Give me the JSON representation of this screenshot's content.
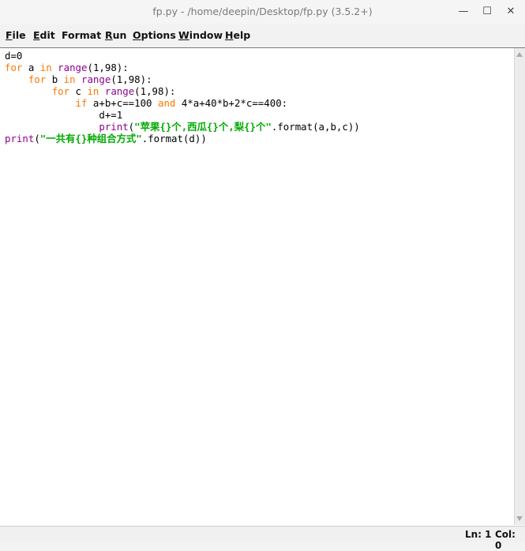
{
  "window": {
    "title": "fp.py - /home/deepin/Desktop/fp.py (3.5.2+)",
    "minimize_glyph": "—",
    "maximize_glyph": "☐",
    "close_glyph": "✕"
  },
  "menu": [
    {
      "u": "F",
      "rest": "ile"
    },
    {
      "u": "E",
      "rest": "dit"
    },
    {
      "u": "",
      "rest": "Format"
    },
    {
      "u": "R",
      "rest": "un"
    },
    {
      "u": "O",
      "rest": "ptions"
    },
    {
      "u": "W",
      "rest": "indow"
    },
    {
      "u": "H",
      "rest": "elp"
    }
  ],
  "code": {
    "line1": "d=0",
    "line2_kw1": "for",
    "line2_a": " a ",
    "line2_kw2": "in",
    "line2_sp": " ",
    "line2_bi": "range",
    "line2_rest": "(1,98):",
    "line3_indent": "    ",
    "line3_kw1": "for",
    "line3_b": " b ",
    "line3_kw2": "in",
    "line3_sp": " ",
    "line3_bi": "range",
    "line3_rest": "(1,98):",
    "line4_indent": "        ",
    "line4_kw1": "for",
    "line4_c": " c ",
    "line4_kw2": "in",
    "line4_sp": " ",
    "line4_bi": "range",
    "line4_rest": "(1,98):",
    "line5_indent": "            ",
    "line5_kw1": "if",
    "line5_mid": " a+b+c==100 ",
    "line5_kw2": "and",
    "line5_rest": " 4*a+40*b+2*c==400:",
    "line6_indent": "                ",
    "line6_text": "d+=1",
    "line7_indent": "                ",
    "line7_bi": "print",
    "line7_open": "(",
    "line7_str": "\"苹果{}个,西瓜{}个,梨{}个\"",
    "line7_rest": ".format(a,b,c))",
    "line8_bi": "print",
    "line8_open": "(",
    "line8_str": "\"一共有{}种组合方式\"",
    "line8_rest": ".format(d))"
  },
  "status": {
    "line": "Ln: 1",
    "col": "Col: 0"
  }
}
